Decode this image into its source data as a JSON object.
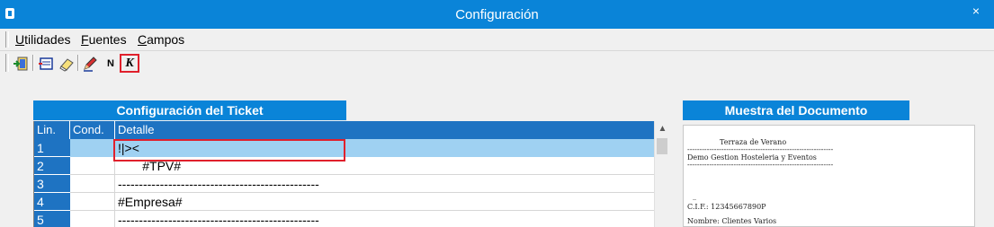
{
  "window": {
    "title": "Configuración",
    "close_glyph": "×"
  },
  "menu": [
    {
      "hotkey": "U",
      "rest": "tilidades"
    },
    {
      "hotkey": "F",
      "rest": "uentes"
    },
    {
      "hotkey": "C",
      "rest": "ampos"
    }
  ],
  "toolbar_icons": [
    "exit-icon",
    "insert-field-icon",
    "eraser-icon",
    "pencil-icon",
    "bold-icon",
    "italic-icon"
  ],
  "toolbar_glyphs": {
    "bold": "N",
    "italic": "K"
  },
  "ticket": {
    "header": "Configuración del Ticket",
    "columns": [
      "Lin.",
      "Cond.",
      "Detalle"
    ],
    "rows": [
      {
        "lin": "1",
        "cond": "",
        "detail": "!|><"
      },
      {
        "lin": "2",
        "cond": "",
        "detail": "       #TPV#"
      },
      {
        "lin": "3",
        "cond": "",
        "detail": "------------------------------------------------"
      },
      {
        "lin": "4",
        "cond": "",
        "detail": "#Empresa#"
      },
      {
        "lin": "5",
        "cond": "",
        "detail": "------------------------------------------------"
      }
    ],
    "selected_row": 1
  },
  "preview": {
    "header": "Muestra del Documento",
    "lines": [
      "Terraza de Verano",
      "------------------------------------------------------------",
      "Demo Gestion Hosteleria y Eventos",
      "------------------------------------------------------------",
      "_",
      "C.I.F.: 12345667890P",
      "Nombre: Clientes Varios"
    ]
  },
  "colors": {
    "title_bar": "#0a84d8",
    "header_blue": "#1e73c2",
    "selection": "#9fd1f2",
    "highlight_border": "#e0202c"
  }
}
